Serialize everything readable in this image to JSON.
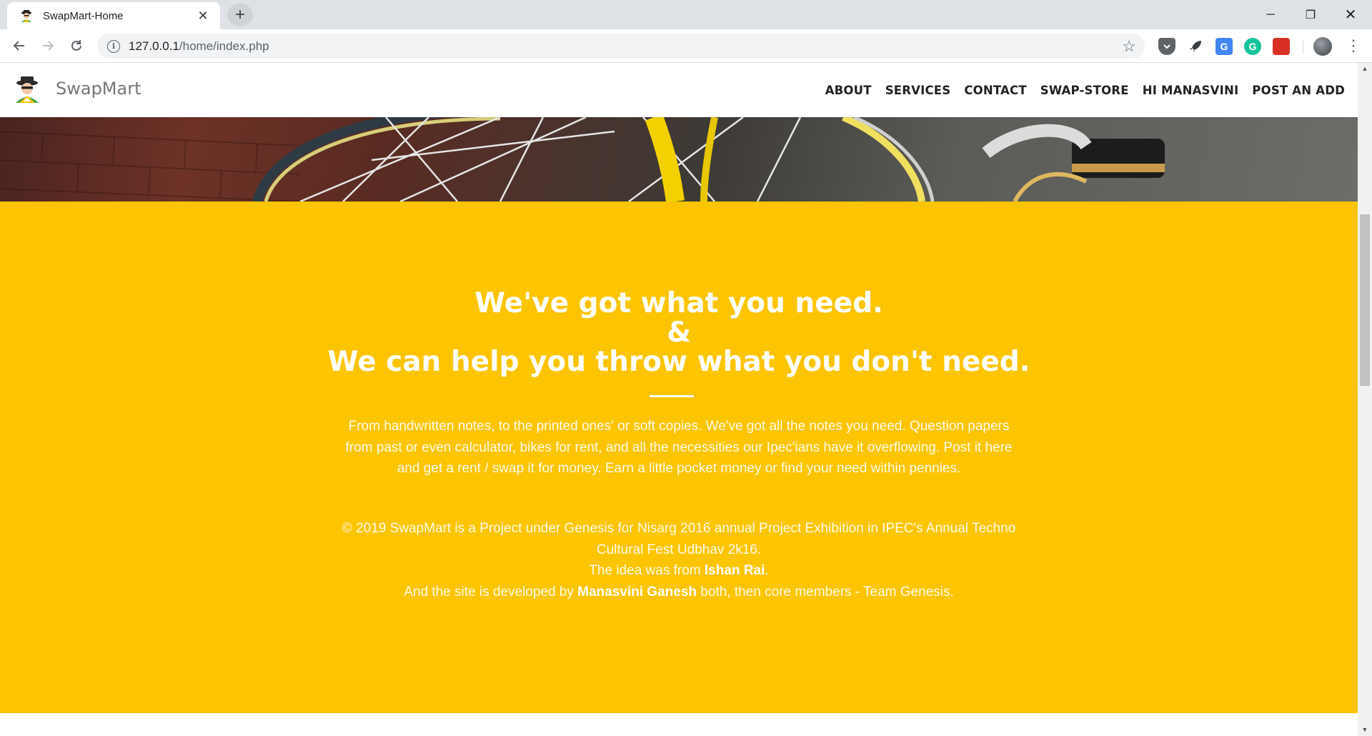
{
  "browser": {
    "tab_title": "SwapMart-Home",
    "url_host": "127.0.0.1",
    "url_path": "/home/index.php",
    "window_controls": {
      "minimize": "─",
      "maximize": "❐",
      "close": "✕"
    },
    "icons": [
      "back-arrow-icon",
      "forward-arrow-icon",
      "reload-icon",
      "info-icon",
      "bookmark-star-icon",
      "pocket-icon",
      "rocket-icon",
      "translate-icon",
      "grammarly-icon",
      "book-icon",
      "profile-avatar",
      "menu-dots-icon"
    ]
  },
  "site": {
    "brand": "SwapMart",
    "nav": [
      {
        "label": "ABOUT"
      },
      {
        "label": "SERVICES"
      },
      {
        "label": "CONTACT"
      },
      {
        "label": "SWAP-STORE"
      },
      {
        "label": "HI MANASVINI"
      },
      {
        "label": "POST AN ADD"
      }
    ],
    "accent_color": "#fcc401"
  },
  "section": {
    "heading_line1": "We've got what you need.",
    "heading_line2": "&",
    "heading_line3": "We can help you throw what you don't need.",
    "paragraph1": "From handwritten notes, to the printed ones' or soft copies. We've got all the notes you need. Question papers from past or even calculator, bikes for rent, and all the necessities our Ipec'ians have it overflowing. Post it here and get a rent / swap it for money. Earn a little pocket money or find your need within pennies.",
    "credits_line1": "© 2019 SwapMart is a Project under Genesis for Nisarg 2016 annual Project Exhibition in IPEC's Annual Techno Cultural Fest Udbhav 2k16.",
    "credits_idea_prefix": "The idea was from ",
    "credits_idea_name": "Ishan Rai",
    "credits_idea_suffix": ".",
    "credits_dev_prefix": "And the site is developed by ",
    "credits_dev_name": "Manasvini Ganesh",
    "credits_dev_suffix": " both, then core members - Team Genesis."
  }
}
